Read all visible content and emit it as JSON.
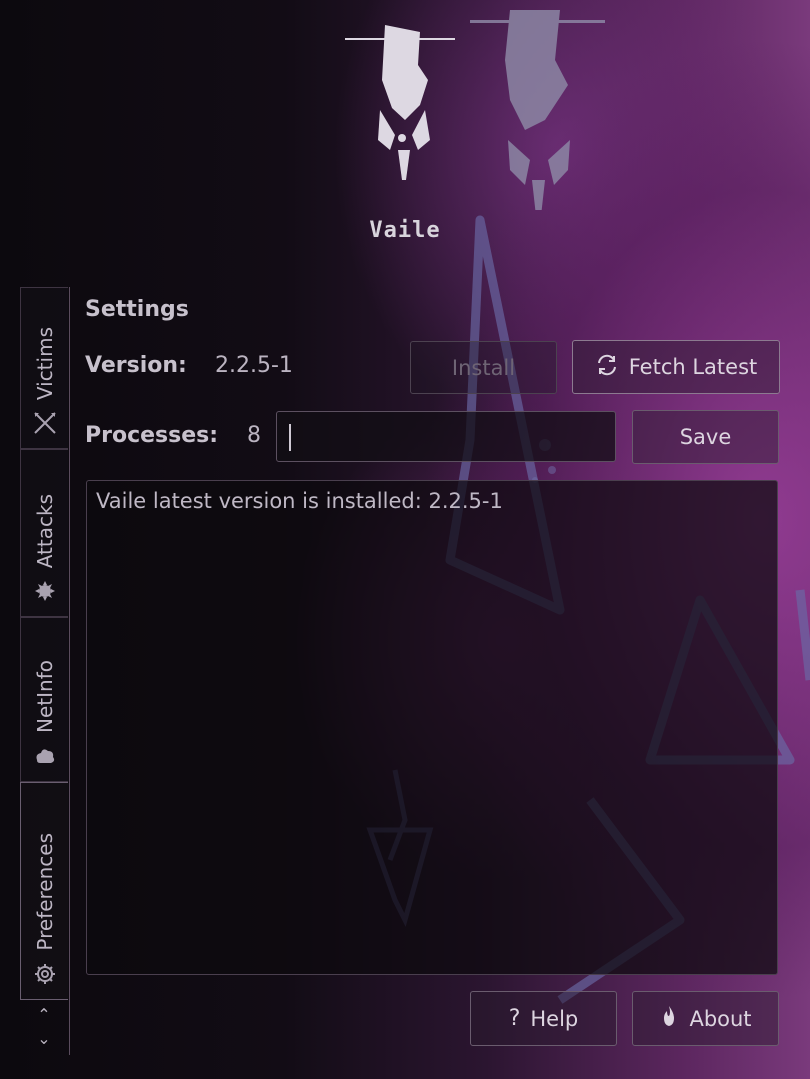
{
  "app": {
    "title": "Vaile"
  },
  "sidebar": {
    "tabs": [
      {
        "label": "Victims",
        "icon": "crossed-swords-icon"
      },
      {
        "label": "Attacks",
        "icon": "gear-burst-icon"
      },
      {
        "label": "NetInfo",
        "icon": "fire-cloud-icon"
      },
      {
        "label": "Preferences",
        "icon": "gear-icon",
        "active": true
      }
    ],
    "scroll_up": "⌃",
    "scroll_down": "⌄"
  },
  "settings": {
    "heading": "Settings",
    "version_label": "Version:",
    "version_value": "2.2.5-1",
    "install_label": "Install",
    "fetch_label": "Fetch Latest",
    "processes_label": "Processes:",
    "processes_value": "8",
    "processes_input": "",
    "save_label": "Save",
    "log_text": "Vaile latest version is installed: 2.2.5-1"
  },
  "footer": {
    "help_label": "Help",
    "about_label": "About"
  },
  "colors": {
    "accent": "#7a3a7c",
    "background": "#0f0b12"
  }
}
